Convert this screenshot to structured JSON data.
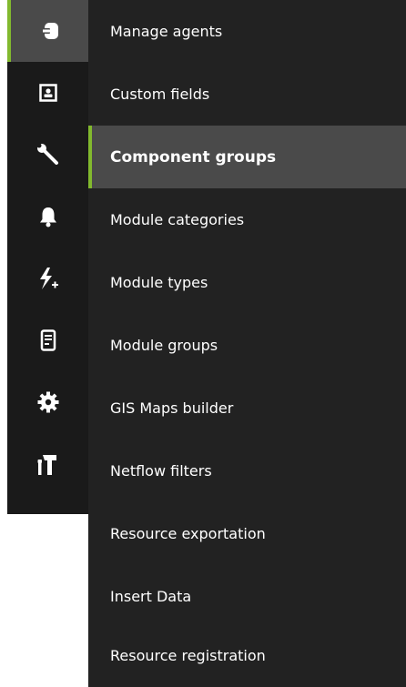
{
  "rail": {
    "icons": [
      "agent-connect-icon",
      "contact-card-icon",
      "wrench-icon",
      "bell-icon",
      "bolt-plus-icon",
      "server-icon",
      "gear-icon",
      "hammer-icon"
    ],
    "active_index": 0
  },
  "submenu": {
    "items": [
      {
        "label": "Manage agents"
      },
      {
        "label": "Custom fields"
      },
      {
        "label": "Component groups"
      },
      {
        "label": "Module categories"
      },
      {
        "label": "Module types"
      },
      {
        "label": "Module groups"
      },
      {
        "label": "GIS Maps builder"
      },
      {
        "label": "Netflow filters"
      },
      {
        "label": "Resource exportation"
      },
      {
        "label": "Insert Data"
      },
      {
        "label": "Resource registration"
      }
    ],
    "active_index": 2
  },
  "colors": {
    "rail_bg": "#1a1a1a",
    "submenu_bg": "#222222",
    "active_bg": "#4a4a4a",
    "accent": "#82b92e",
    "text": "#ffffff"
  }
}
